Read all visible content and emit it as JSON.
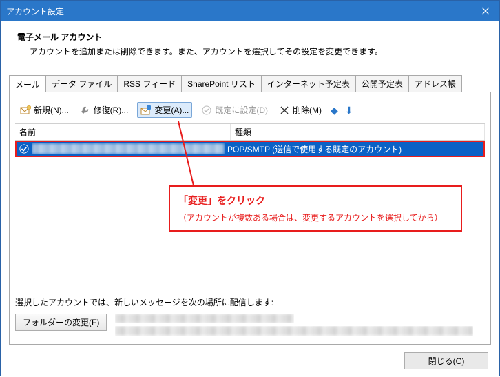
{
  "window": {
    "title": "アカウント設定"
  },
  "header": {
    "title": "電子メール アカウント",
    "description": "アカウントを追加または削除できます。また、アカウントを選択してその設定を変更できます。"
  },
  "tabs": {
    "mail": "メール",
    "data_file": "データ ファイル",
    "rss": "RSS フィード",
    "sharepoint": "SharePoint リスト",
    "internet_cal": "インターネット予定表",
    "published_cal": "公開予定表",
    "address_book": "アドレス帳"
  },
  "toolbar": {
    "new": "新規(N)...",
    "repair": "修復(R)...",
    "change": "変更(A)...",
    "set_default": "既定に設定(D)",
    "delete": "削除(M)"
  },
  "columns": {
    "name": "名前",
    "type": "種類"
  },
  "row": {
    "type_value": "POP/SMTP (送信で使用する既定のアカウント)"
  },
  "callout": {
    "line1": "「変更」をクリック",
    "line2": "（アカウントが複数ある場合は、変更するアカウントを選択してから）"
  },
  "delivery": {
    "caption": "選択したアカウントでは、新しいメッセージを次の場所に配信します:",
    "change_folder_btn": "フォルダーの変更(F)"
  },
  "footer": {
    "close": "閉じる(C)"
  }
}
